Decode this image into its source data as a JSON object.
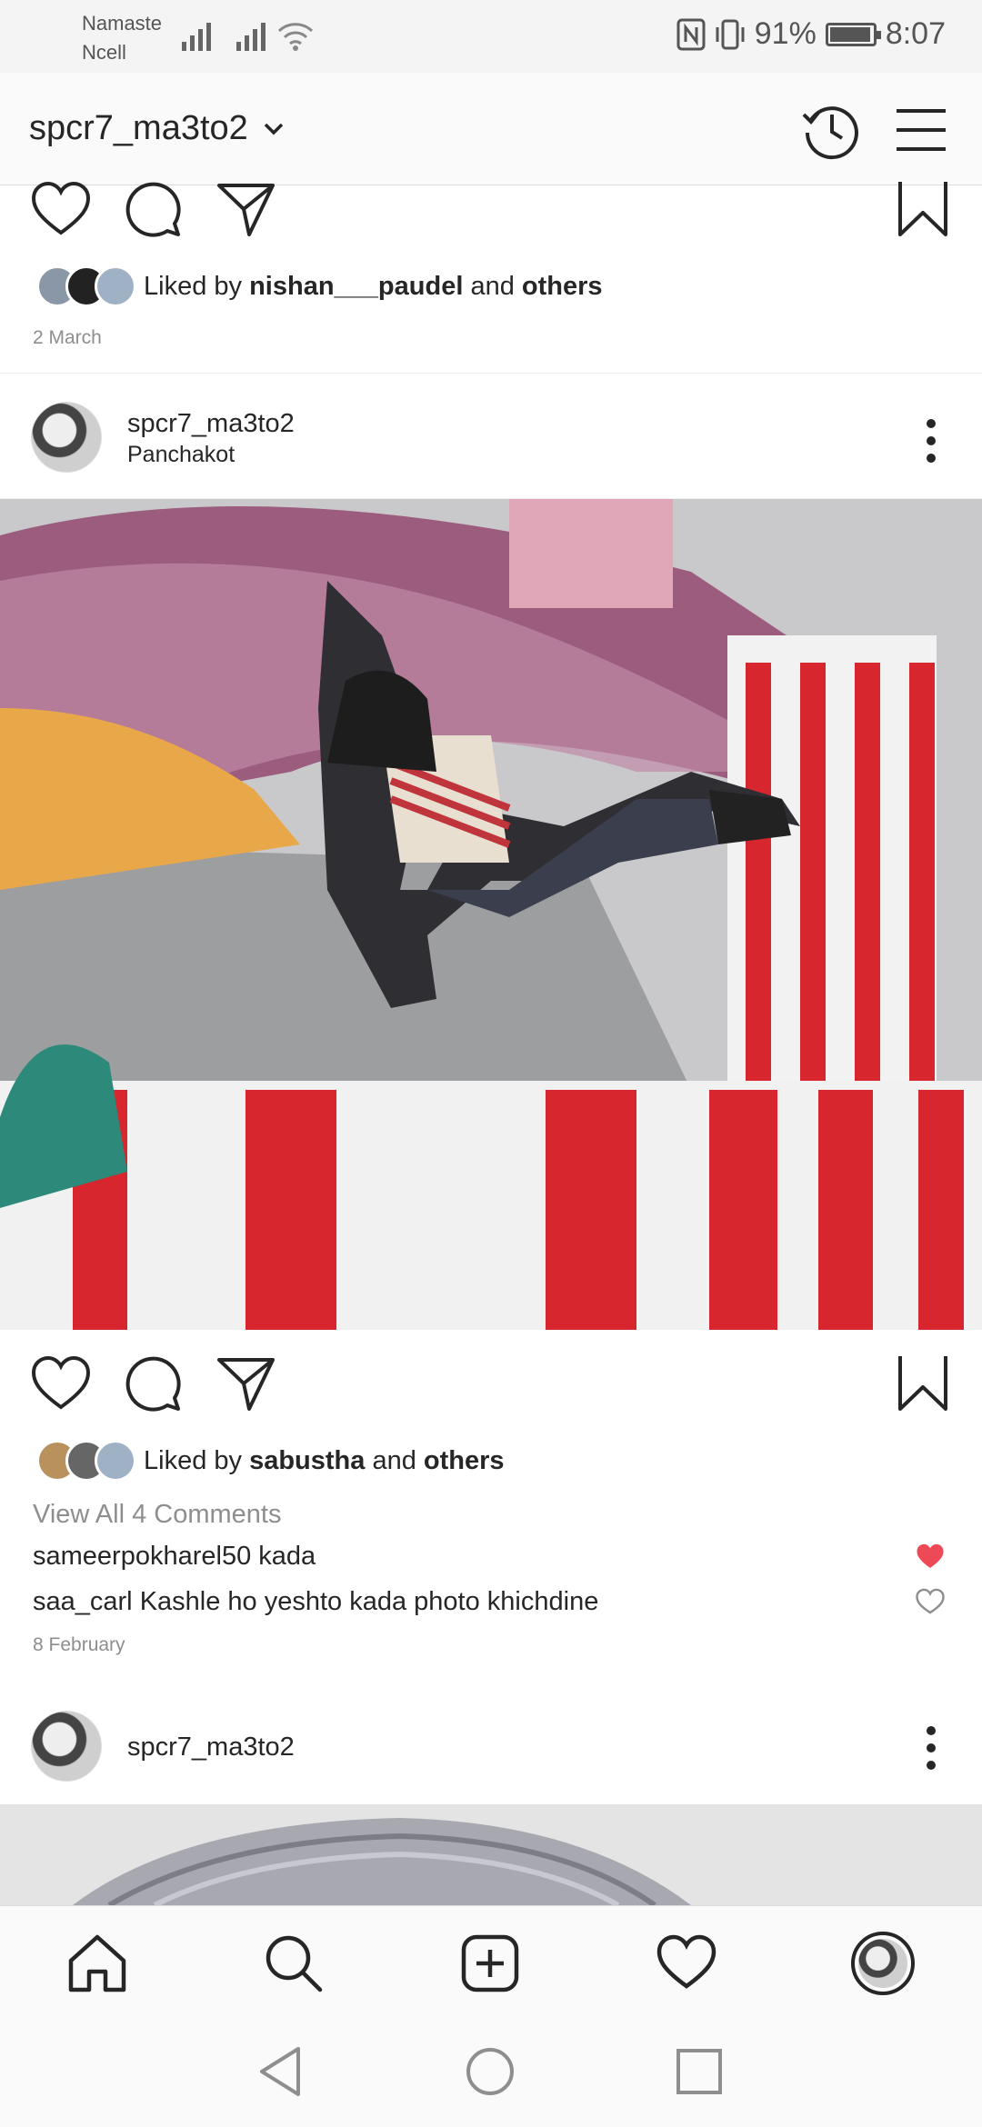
{
  "status_bar": {
    "carrier_line1": "Namaste",
    "carrier_line2": "Ncell",
    "battery": "91%",
    "time": "8:07"
  },
  "header": {
    "account_name": "spcr7_ma3to2"
  },
  "post1": {
    "liked_prefix": "Liked by",
    "liked_user": "nishan___paudel",
    "liked_and": "and",
    "liked_others": "others",
    "date": "2 March"
  },
  "post2": {
    "username": "spcr7_ma3to2",
    "location": "Panchakot",
    "liked_prefix": "Liked by",
    "liked_user": "sabustha",
    "liked_and": "and",
    "liked_others": "others",
    "view_all": "View All 4 Comments",
    "comments": [
      {
        "user": "sameerpokharel50",
        "text": "kada",
        "liked": true
      },
      {
        "user": "saa_carl",
        "text": "Kashle ho yeshto kada photo khichdine",
        "liked": false
      }
    ],
    "date": "8 February"
  },
  "post3": {
    "username": "spcr7_ma3to2"
  },
  "colors": {
    "liked_heart": "#ed4956",
    "text": "#262626",
    "muted": "#8e8e8e"
  },
  "icons": {
    "nav": [
      "home-icon",
      "search-icon",
      "new-post-icon",
      "activity-heart-icon",
      "profile-avatar"
    ],
    "system": [
      "back-triangle-icon",
      "home-circle-icon",
      "recents-square-icon"
    ]
  }
}
